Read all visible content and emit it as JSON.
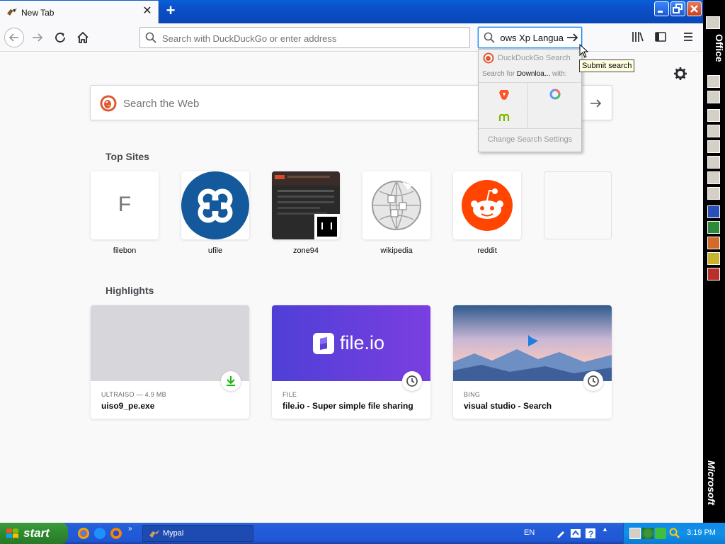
{
  "browser": {
    "tab": {
      "title": "New Tab"
    },
    "url_placeholder": "Search with DuckDuckGo or enter address",
    "search_value": "ows Xp Langua",
    "search_popup": {
      "engine": "DuckDuckGo Search",
      "search_for_prefix": "Search for",
      "search_for_term": "Downloa...",
      "search_for_suffix": "with:",
      "change_settings": "Change Search Settings"
    },
    "tooltip": "Submit search"
  },
  "newtab": {
    "web_search_placeholder": "Search the Web",
    "top_sites_title": "Top Sites",
    "top_sites": [
      {
        "label": "filebon",
        "letter": "F"
      },
      {
        "label": "ufile"
      },
      {
        "label": "zone94"
      },
      {
        "label": "wikipedia"
      },
      {
        "label": "reddit"
      }
    ],
    "highlights_title": "Highlights",
    "highlights": [
      {
        "context": "ULTRAISO — 4.9 MB",
        "title": "uiso9_pe.exe"
      },
      {
        "context": "FILE",
        "title": "file.io - Super simple file sharing",
        "brand": "file.io"
      },
      {
        "context": "BING",
        "title": "visual studio - Search"
      }
    ]
  },
  "office_bar": {
    "label": "Office",
    "brand": "Microsoft"
  },
  "taskbar": {
    "start": "start",
    "task_item": "Mypal",
    "lang": "EN",
    "time": "3:19 PM"
  }
}
